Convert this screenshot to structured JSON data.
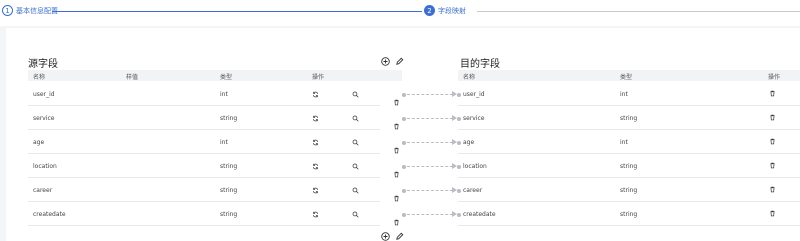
{
  "stepper": {
    "steps": [
      {
        "num": "1",
        "label": "基本信息配置"
      },
      {
        "num": "2",
        "label": "字段映射"
      }
    ]
  },
  "source": {
    "title": "源字段",
    "columns": [
      "名称",
      "样值",
      "类型",
      "操作"
    ],
    "rows": [
      {
        "name": "user_id",
        "sample": "",
        "type": "int"
      },
      {
        "name": "service",
        "sample": "",
        "type": "string"
      },
      {
        "name": "age",
        "sample": "",
        "type": "int"
      },
      {
        "name": "location",
        "sample": "",
        "type": "string"
      },
      {
        "name": "career",
        "sample": "",
        "type": "string"
      },
      {
        "name": "createdate",
        "sample": "",
        "type": "string"
      }
    ]
  },
  "target": {
    "title": "目的字段",
    "columns": [
      "名称",
      "类型",
      "操作"
    ],
    "rows": [
      {
        "name": "user_id",
        "type": "int"
      },
      {
        "name": "service",
        "type": "string"
      },
      {
        "name": "age",
        "type": "int"
      },
      {
        "name": "location",
        "type": "string"
      },
      {
        "name": "career",
        "type": "string"
      },
      {
        "name": "createdate",
        "type": "string"
      }
    ]
  },
  "icons": {
    "add": "plus-circle-icon",
    "edit": "pencil-icon",
    "convert": "refresh-icon",
    "search": "search-icon",
    "delete": "trash-icon"
  },
  "colors": {
    "accent": "#3b6fd4",
    "header_bg": "#f2f3f5",
    "connector": "#b9bcc2"
  }
}
